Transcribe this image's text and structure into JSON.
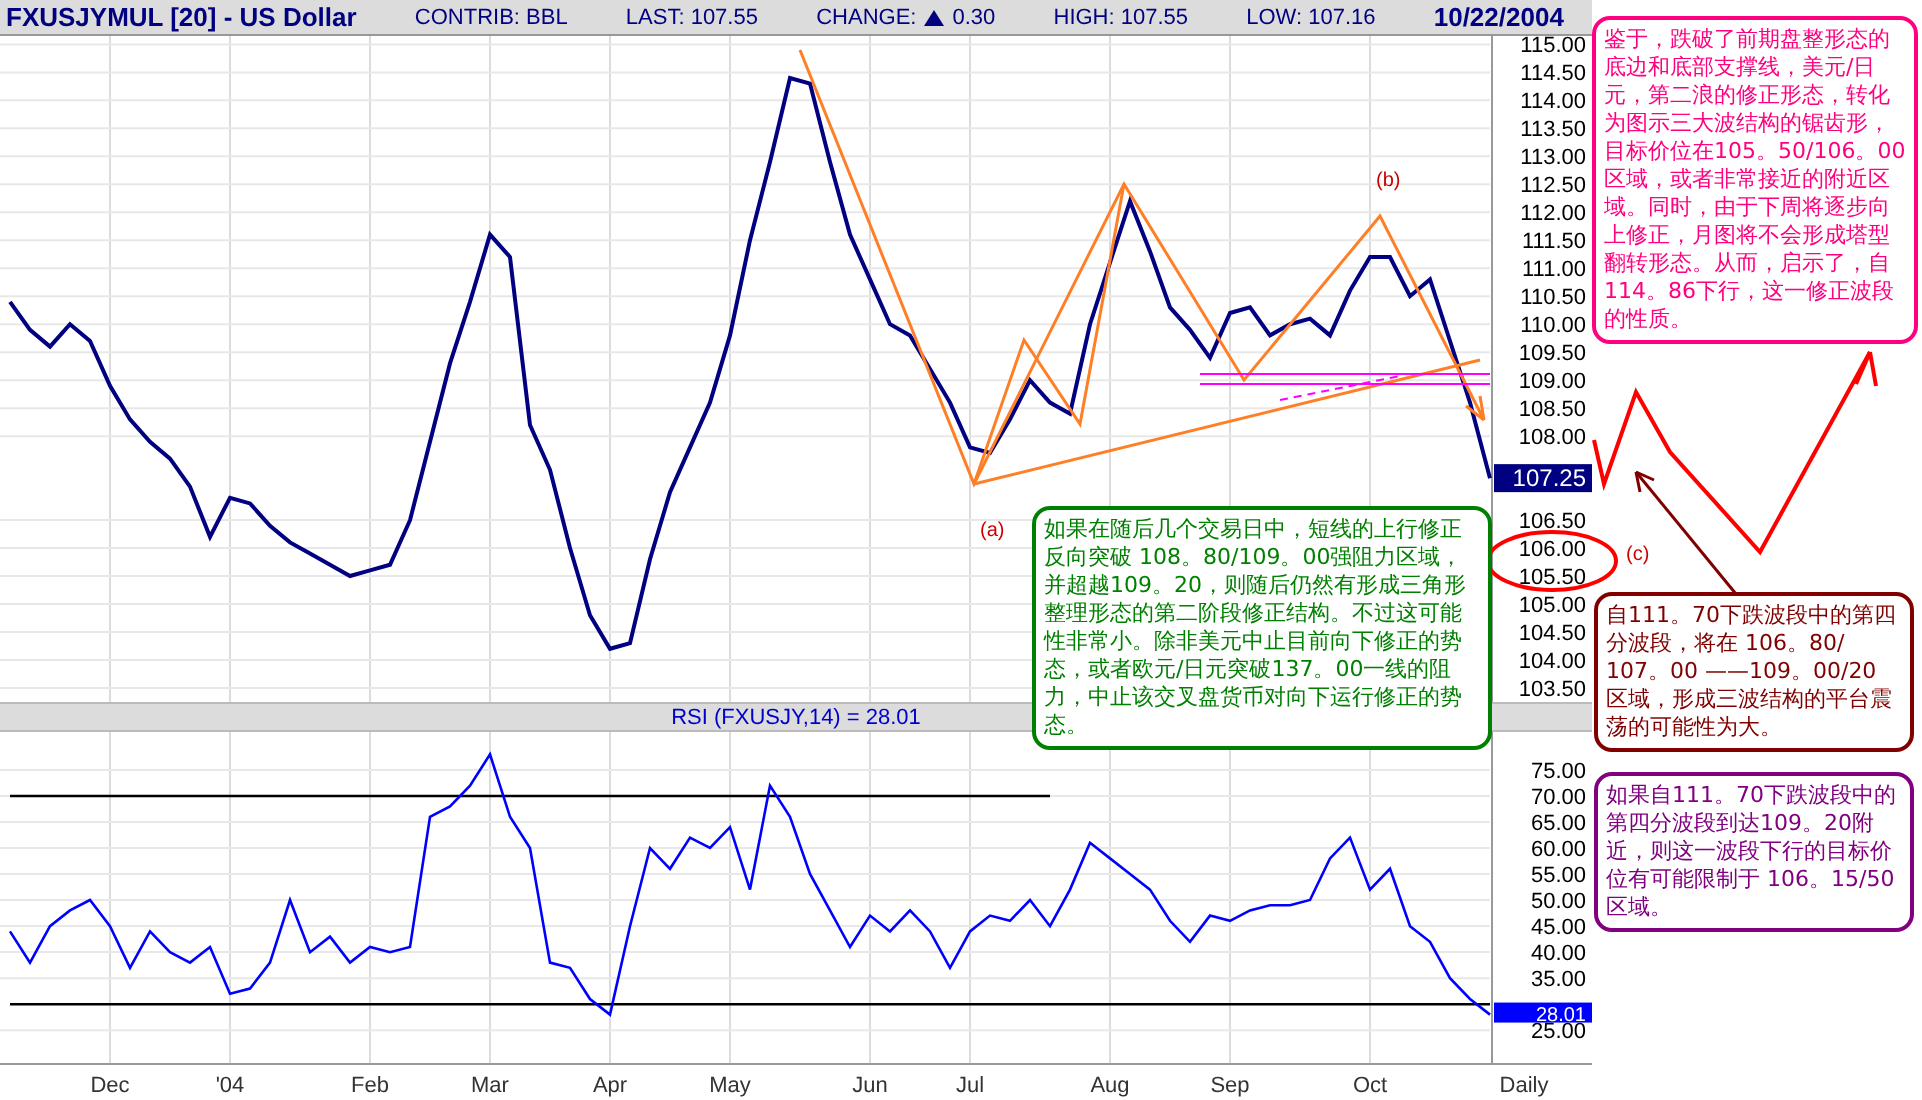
{
  "header": {
    "symbol": "FXUSJYMUL [20] - US Dollar",
    "contrib": "CONTRIB: BBL",
    "last": "LAST: 107.55",
    "change_label": "CHANGE:",
    "change_up": true,
    "change_value": "0.30",
    "high": "HIGH: 107.55",
    "low": "LOW: 107.16",
    "date": "10/22/2004"
  },
  "price_panel": {
    "chart_data": {
      "type": "line",
      "grid": true,
      "ylim": [
        103.25,
        115.15
      ],
      "yticks": [
        {
          "value": 115,
          "label": "115.00"
        },
        {
          "value": 114.5,
          "label": "114.50"
        },
        {
          "value": 114,
          "label": "114.00"
        },
        {
          "value": 113.5,
          "label": "113.50"
        },
        {
          "value": 113,
          "label": "113.00"
        },
        {
          "value": 112.5,
          "label": "112.50"
        },
        {
          "value": 112,
          "label": "112.00"
        },
        {
          "value": 111.5,
          "label": "111.50"
        },
        {
          "value": 111,
          "label": "111.00"
        },
        {
          "value": 110.5,
          "label": "110.50"
        },
        {
          "value": 110,
          "label": "110.00"
        },
        {
          "value": 109.5,
          "label": "109.50"
        },
        {
          "value": 109,
          "label": "109.00"
        },
        {
          "value": 108.5,
          "label": "108.50"
        },
        {
          "value": 108,
          "label": "108.00"
        },
        {
          "value": 106.5,
          "label": "106.50"
        },
        {
          "value": 106,
          "label": "106.00"
        },
        {
          "value": 105.5,
          "label": "105.50"
        },
        {
          "value": 105,
          "label": "105.00"
        },
        {
          "value": 104.5,
          "label": "104.50"
        },
        {
          "value": 104,
          "label": "104.00"
        },
        {
          "value": 103.5,
          "label": "103.50"
        }
      ],
      "categories": [
        null,
        null,
        null,
        null,
        null,
        null,
        null,
        null,
        null,
        null,
        null,
        null,
        null,
        null,
        null,
        null,
        null,
        null,
        null,
        null,
        null,
        null,
        null,
        null,
        null,
        null,
        null,
        null,
        null,
        null,
        null,
        null,
        null,
        null,
        null,
        null,
        null,
        null,
        null,
        null,
        null,
        null,
        null,
        null,
        null,
        null,
        null,
        null,
        null,
        null,
        null,
        null,
        null,
        null,
        null,
        null,
        null,
        null,
        null,
        null,
        null,
        null,
        null,
        null,
        null,
        null,
        null,
        null,
        null,
        null,
        null,
        null,
        null,
        null,
        null
      ],
      "series": [
        {
          "color": "#000080",
          "values": [
            110.4,
            109.9,
            109.6,
            110.0,
            109.7,
            108.9,
            108.3,
            107.9,
            107.6,
            107.1,
            106.2,
            106.9,
            106.8,
            106.4,
            106.1,
            105.9,
            105.7,
            105.5,
            105.6,
            105.7,
            106.5,
            107.9,
            109.3,
            110.4,
            111.6,
            111.2,
            108.2,
            107.4,
            106.0,
            104.8,
            104.2,
            104.3,
            105.8,
            107.0,
            107.8,
            108.6,
            109.8,
            111.5,
            112.9,
            114.4,
            114.3,
            112.9,
            111.6,
            110.8,
            110.0,
            109.8,
            109.2,
            108.6,
            107.8,
            107.7,
            108.3,
            109.0,
            108.6,
            108.4,
            110.0,
            111.1,
            112.2,
            111.3,
            110.3,
            109.9,
            109.4,
            110.2,
            110.3,
            109.8,
            110.0,
            110.1,
            109.8,
            110.6,
            111.2,
            111.2,
            110.5,
            110.8,
            109.7,
            108.6,
            107.25
          ]
        }
      ],
      "annotations": [
        "(a)",
        "(b)",
        "(c)",
        "107.25"
      ]
    }
  },
  "rsi_panel": {
    "chart_data": {
      "type": "line",
      "grid": true,
      "title": "RSI (FXUSJY,14) = 28.01",
      "xlabel": "Daily",
      "ylim": [
        18.5,
        82.3
      ],
      "categories": [
        null,
        null,
        null,
        null,
        null,
        "Dec",
        null,
        null,
        null,
        null,
        null,
        "'04",
        null,
        null,
        null,
        null,
        null,
        null,
        "Feb",
        null,
        null,
        null,
        null,
        null,
        "Mar",
        null,
        null,
        null,
        null,
        null,
        "Apr",
        null,
        null,
        null,
        null,
        null,
        "May",
        null,
        null,
        null,
        null,
        null,
        null,
        "Jun",
        null,
        null,
        null,
        null,
        "Jul",
        null,
        null,
        null,
        null,
        null,
        null,
        "Aug",
        null,
        null,
        null,
        null,
        null,
        "Sep",
        null,
        null,
        null,
        null,
        null,
        null,
        "Oct",
        null,
        null,
        null,
        null,
        null,
        null
      ],
      "yticks": [
        {
          "value": 75,
          "label": "75.00"
        },
        {
          "value": 70,
          "label": "70.00"
        },
        {
          "value": 65,
          "label": "65.00"
        },
        {
          "value": 60,
          "label": "60.00"
        },
        {
          "value": 55,
          "label": "55.00"
        },
        {
          "value": 50,
          "label": "50.00"
        },
        {
          "value": 45,
          "label": "45.00"
        },
        {
          "value": 40,
          "label": "40.00"
        },
        {
          "value": 35,
          "label": "35.00"
        },
        {
          "value": 25,
          "label": "25.00"
        }
      ],
      "series": [
        {
          "color": "#000000",
          "values": [
            70,
            70,
            70,
            70,
            70,
            70,
            70,
            70,
            70,
            70,
            70,
            70,
            70,
            70,
            70,
            70,
            70,
            70,
            70,
            70,
            70,
            70,
            70,
            70,
            70,
            70,
            70,
            70,
            70,
            70,
            70,
            70,
            70,
            70,
            70,
            70,
            70,
            70,
            70,
            70,
            70,
            70,
            70,
            70,
            70,
            70,
            70,
            70,
            70,
            70,
            70,
            70,
            70,
            null,
            null,
            null,
            null,
            null,
            null,
            null,
            null,
            null,
            null,
            null,
            null,
            null,
            null,
            null,
            null,
            null,
            null,
            null,
            null,
            null,
            null
          ]
        },
        {
          "color": "#000000",
          "values": [
            30,
            30,
            30,
            30,
            30,
            30,
            30,
            30,
            30,
            30,
            30,
            30,
            30,
            30,
            30,
            30,
            30,
            30,
            30,
            30,
            30,
            30,
            30,
            30,
            30,
            30,
            30,
            30,
            30,
            30,
            30,
            30,
            30,
            30,
            30,
            30,
            30,
            30,
            30,
            30,
            30,
            30,
            30,
            30,
            30,
            30,
            30,
            30,
            30,
            30,
            30,
            30,
            30,
            30,
            30,
            30,
            30,
            30,
            30,
            30,
            30,
            30,
            30,
            30,
            30,
            30,
            30,
            30,
            30,
            30,
            30,
            30,
            30,
            30,
            30
          ]
        },
        {
          "color": "#0000ff",
          "values": [
            44,
            38,
            45,
            48,
            50,
            45,
            37,
            44,
            40,
            38,
            41,
            32,
            33,
            38,
            50,
            40,
            43,
            38,
            41,
            40,
            41,
            66,
            68,
            72,
            78,
            66,
            60,
            38,
            37,
            31,
            28,
            45,
            60,
            56,
            62,
            60,
            64,
            52,
            72,
            66,
            55,
            48,
            41,
            47,
            44,
            48,
            44,
            37,
            44,
            47,
            46,
            50,
            45,
            52,
            61,
            58,
            55,
            52,
            46,
            42,
            47,
            46,
            48,
            49,
            49,
            50,
            58,
            62,
            52,
            56,
            45,
            42,
            35,
            31,
            28
          ]
        }
      ],
      "annotations": [
        "28.01"
      ]
    }
  },
  "notes": [
    {
      "color": "#ff0080",
      "text": "鉴于，跌破了前期盘整形态的底边和底部支撑线，美元/日元，第二浪的修正形态，转化为图示三大波结构的锯齿形，目标价位在105。50/106。00区域，或者非常接近的附近区域。同时，由于下周将逐步向上修正，月图将不会形成塔型翻转形态。从而，启示了，自114。86下行，这一修正波段的性质。"
    },
    {
      "color": "#008000",
      "text": "如果在随后几个交易日中，短线的上行修正反向突破 108。80/109。00强阻力区域，并超越109。20，则随后仍然有形成三角形整理形态的第二阶段修正结构。不过这可能性非常小。除非美元中止目前向下修正的势态，或者欧元/日元突破137。00一线的阻力，中止该交叉盘货币对向下运行修正的势态。"
    },
    {
      "color": "#800000",
      "text": "自111。70下跌波段中的第四分波段，将在 106。80/ 107。00 ——109。00/20 区域，形成三波结构的平台震荡的可能性为大。"
    },
    {
      "color": "#800080",
      "text": "如果自111。70下跌波段中的第四分波段到达109。20附近，则这一波段下行的目标价位有可能限制于 106。15/50区域。"
    }
  ]
}
